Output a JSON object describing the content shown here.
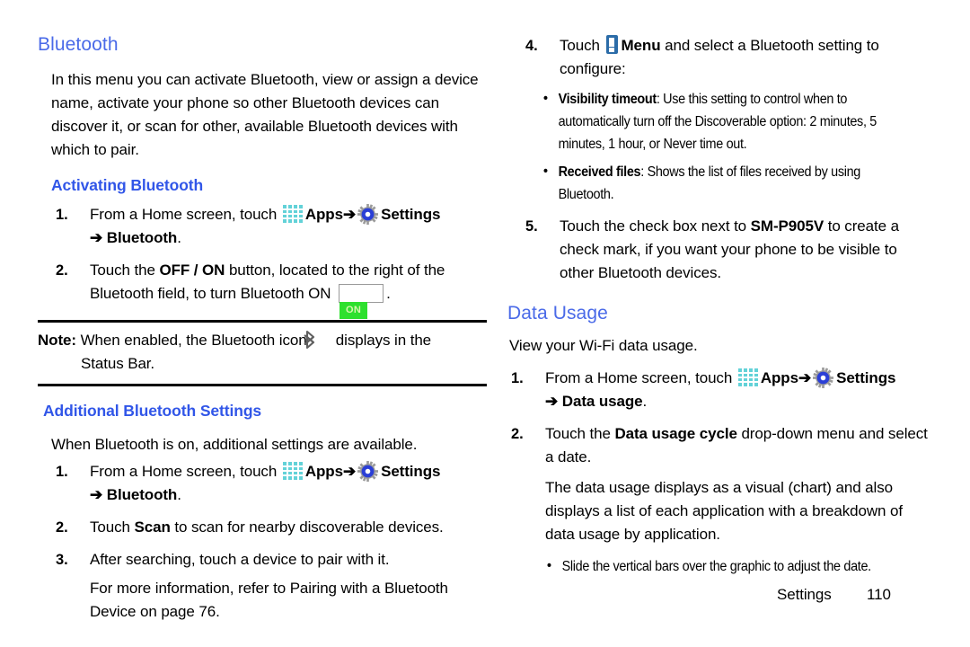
{
  "document": {
    "footer": {
      "section_label": "Settings",
      "page_number": "110"
    }
  },
  "colors": {
    "heading_primary": "#4a6ae8",
    "heading_secondary": "#3156e8",
    "apps_icon": "#63d2d8",
    "gear_icon": "#2b3fd6",
    "menu_icon": "#2b6ca8",
    "toggle_on": "#2ee02e",
    "text": "#000000"
  },
  "left_column": {
    "heading": "Bluetooth",
    "intro_paragraph": "In this menu you can activate Bluetooth, view or assign a device name, activate your phone so other Bluetooth devices can discover it, or scan for other, available Bluetooth devices with which to pair.",
    "activating": {
      "heading": "Activating Bluetooth",
      "steps": [
        {
          "number": "1.",
          "text_before_apps": "From a Home screen, touch ",
          "apps_label": "Apps",
          "arrow1": "➔",
          "settings_label": "Settings",
          "arrow2": "➔",
          "target_label": "Bluetooth",
          "period": "."
        },
        {
          "number": "2.",
          "part1": "Touch the ",
          "bold1": "OFF / ON",
          "part2": " button, located to the right of the Bluetooth field, to turn Bluetooth ON ",
          "toggle_label": "ON",
          "part3": "."
        }
      ]
    },
    "note": {
      "label": "Note:",
      "text_before_icon": " When enabled, the Bluetooth icon ",
      "text_after_icon": " displays in the",
      "continuation": "Status Bar."
    },
    "additional": {
      "heading": "Additional Bluetooth Settings",
      "intro": "When Bluetooth is on, additional settings are available.",
      "steps": [
        {
          "number": "1.",
          "text_before_apps": "From a Home screen, touch ",
          "apps_label": "Apps",
          "arrow1": "➔",
          "settings_label": "Settings",
          "arrow2": "➔",
          "target_label": "Bluetooth",
          "period": "."
        },
        {
          "number": "2.",
          "part1": "Touch ",
          "bold1": "Scan",
          "part2": " to scan for nearby discoverable devices."
        },
        {
          "number": "3.",
          "part1": "After searching, touch a device to pair with it.",
          "continuation": "For more information, refer to  Pairing with a Bluetooth Device on page 76."
        }
      ]
    }
  },
  "right_column": {
    "step4": {
      "number": "4.",
      "part1": "Touch ",
      "menu_label": "Menu",
      "part2": " and select a Bluetooth setting to configure:",
      "bullets": [
        {
          "term": "Visibility timeout",
          "description": ": Use this setting to control when to automatically turn off the Discoverable option: 2 minutes, 5 minutes, 1 hour, or Never time out."
        },
        {
          "term": "Received files",
          "description": ": Shows the list of files received by using Bluetooth."
        }
      ]
    },
    "step5": {
      "number": "5.",
      "part1": "Touch the check box next to ",
      "bold1": "SM-P905V",
      "part2": " to create a check mark, if you want your phone to be visible to other Bluetooth devices."
    },
    "data_usage": {
      "heading": "Data Usage",
      "intro": "View your Wi-Fi data usage.",
      "steps": [
        {
          "number": "1.",
          "text_before_apps": "From a Home screen, touch ",
          "apps_label": "Apps",
          "arrow1": "➔",
          "settings_label": "Settings",
          "arrow2": "➔",
          "target_label": "Data usage",
          "period": "."
        },
        {
          "number": "2.",
          "part1": "Touch the ",
          "bold1": "Data usage cycle",
          "part2": " drop-down menu and select a date.",
          "continuation": "The data usage displays as a visual (chart) and also displays a list of each application with a breakdown of data usage by application."
        }
      ],
      "bullet": "Slide the vertical bars over the graphic to adjust the date."
    }
  }
}
